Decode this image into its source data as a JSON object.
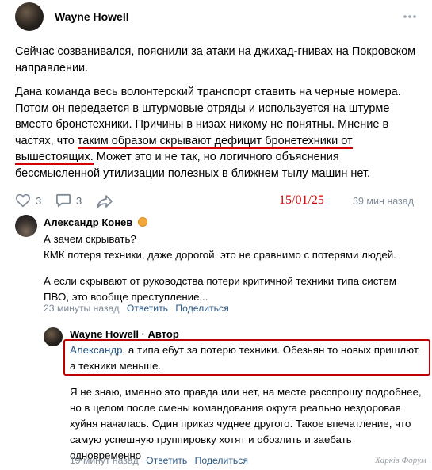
{
  "post": {
    "author": "Wayne Howell",
    "paragraph1": "Сейчас созванивался, пояснили за атаки на джихад-гниваx на Покровском направлении.",
    "p2_line1": "Дана команда весь волонтерский транспорт ставить на черные номера.",
    "p2_line2": "Потом он передается в штурмовые отряды и используется на штурме",
    "p2_line3": "вместо бронетехники. Причины в низах никому не понятны. Мнение в",
    "p2_line4a": "частях, что ",
    "p2_line4b": "таким образом скрывают дефицит бронетехники от",
    "p2_line5a": "вышестоящих.",
    "p2_line5b": " Может это и не так, но логичного объяснения",
    "p2_line6": "бессмысленной утилизации полезных в ближнем тылу машин нет.",
    "likes": "3",
    "comments": "3",
    "date_annotation": "15/01/25",
    "time": "39 мин назад"
  },
  "comment1": {
    "author": "Александр Конев",
    "line1": "А зачем скрывать?",
    "line2": "КМК потеря техники, даже дорогой, это не сравнимо с потерями людей.",
    "line3": "А если скрывают от руководства потери критичной техники типа систем",
    "line4": "ПВО, это вообще преступление...",
    "time": "23 минуты назад",
    "reply": "Ответить",
    "share": "Поделиться"
  },
  "reply1": {
    "author": "Wayne Howell · Автор",
    "mention": "Александр",
    "line1_rest": ", а типа ебут за потерю техники. Обезьян то новых пришлют,",
    "line2": "а техники меньше.",
    "line3": "Я не знаю, именно это правда или нет, на месте расспрошу подробнее,",
    "line4": "но в целом после смены командования округа реально нездоровая",
    "line5": "хуйня началась. Один приказ чуднее другого. Такое впечатление, что",
    "line6": "самую успешную группировку хотят и обозлить и заебать",
    "line7": "одновременно",
    "time": "19 минут назад",
    "reply": "Ответить",
    "share": "Поделиться"
  },
  "watermark": "Харків Форум"
}
